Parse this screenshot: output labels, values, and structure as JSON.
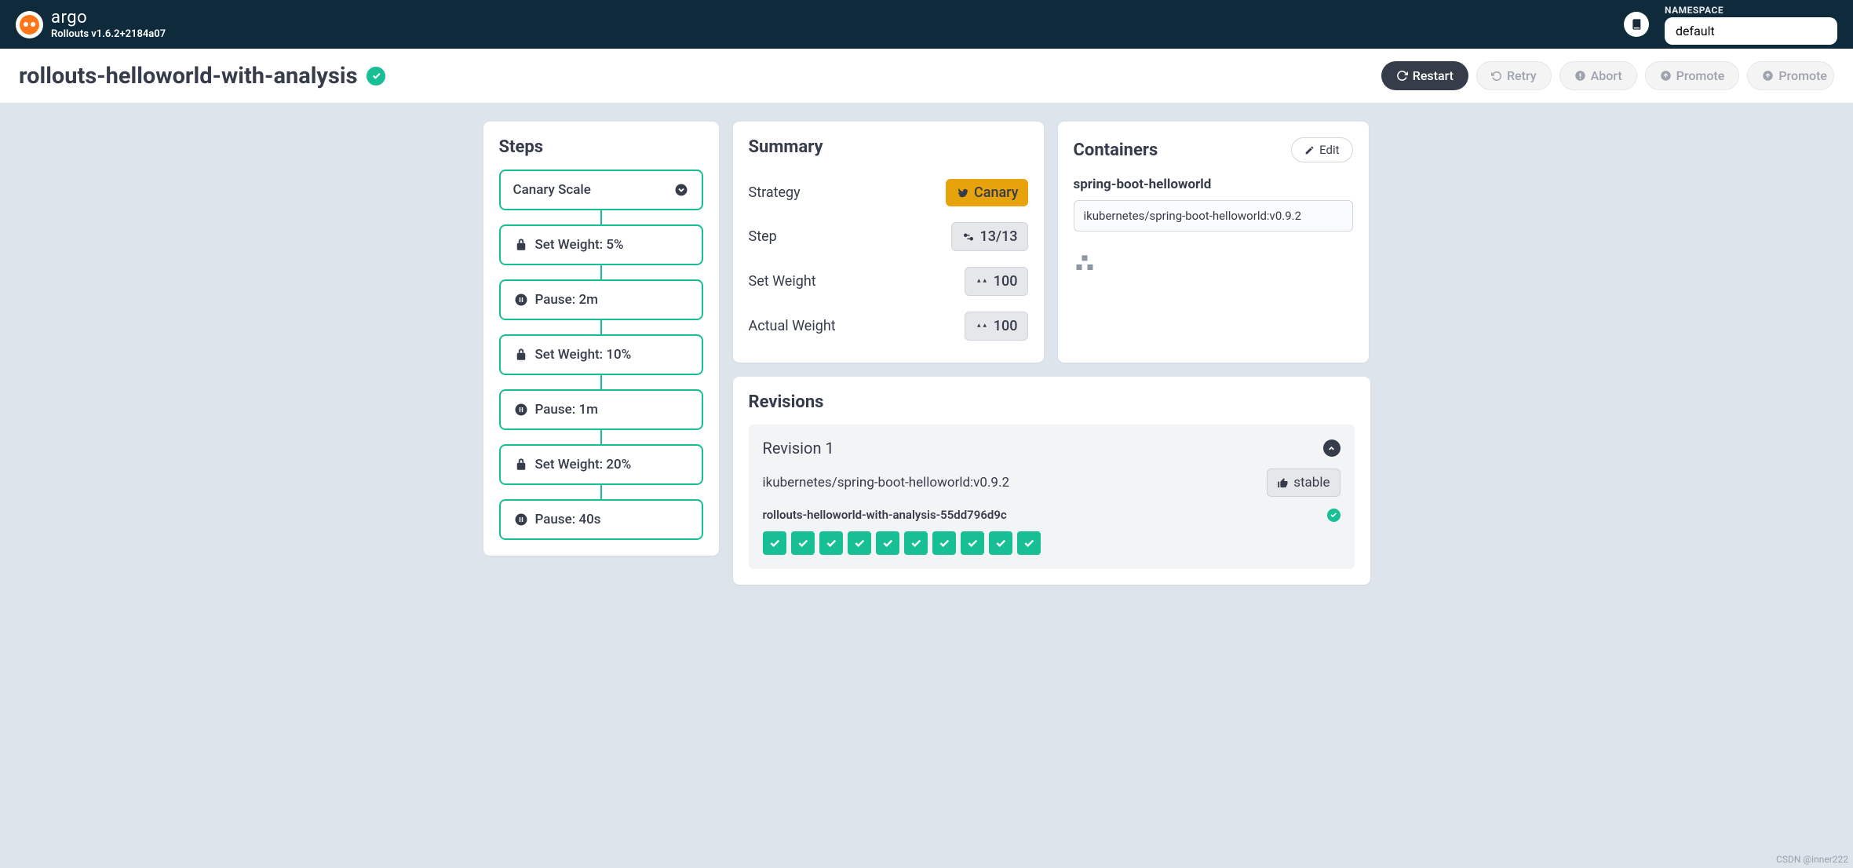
{
  "header": {
    "brand": "argo",
    "version": "Rollouts v1.6.2+2184a07",
    "namespace_label": "NAMESPACE",
    "namespace_value": "default"
  },
  "rollout": {
    "name": "rollouts-helloworld-with-analysis",
    "actions": {
      "restart": "Restart",
      "retry": "Retry",
      "abort": "Abort",
      "promote": "Promote",
      "promote_full": "Promote"
    }
  },
  "steps": {
    "title": "Steps",
    "items": [
      {
        "label": "Canary Scale",
        "type": "scale"
      },
      {
        "label": "Set Weight: 5%",
        "type": "weight"
      },
      {
        "label": "Pause: 2m",
        "type": "pause"
      },
      {
        "label": "Set Weight: 10%",
        "type": "weight"
      },
      {
        "label": "Pause: 1m",
        "type": "pause"
      },
      {
        "label": "Set Weight: 20%",
        "type": "weight"
      },
      {
        "label": "Pause: 40s",
        "type": "pause"
      }
    ]
  },
  "summary": {
    "title": "Summary",
    "strategy_key": "Strategy",
    "strategy_val": "Canary",
    "step_key": "Step",
    "step_val": "13/13",
    "setweight_key": "Set Weight",
    "setweight_val": "100",
    "actualweight_key": "Actual Weight",
    "actualweight_val": "100"
  },
  "containers": {
    "title": "Containers",
    "edit": "Edit",
    "name": "spring-boot-helloworld",
    "image": "ikubernetes/spring-boot-helloworld:v0.9.2"
  },
  "revisions": {
    "title": "Revisions",
    "rev_label": "Revision 1",
    "image": "ikubernetes/spring-boot-helloworld:v0.9.2",
    "stable": "stable",
    "rs_name": "rollouts-helloworld-with-analysis-55dd796d9c",
    "pod_count": 10
  },
  "watermark": "CSDN @inner222"
}
